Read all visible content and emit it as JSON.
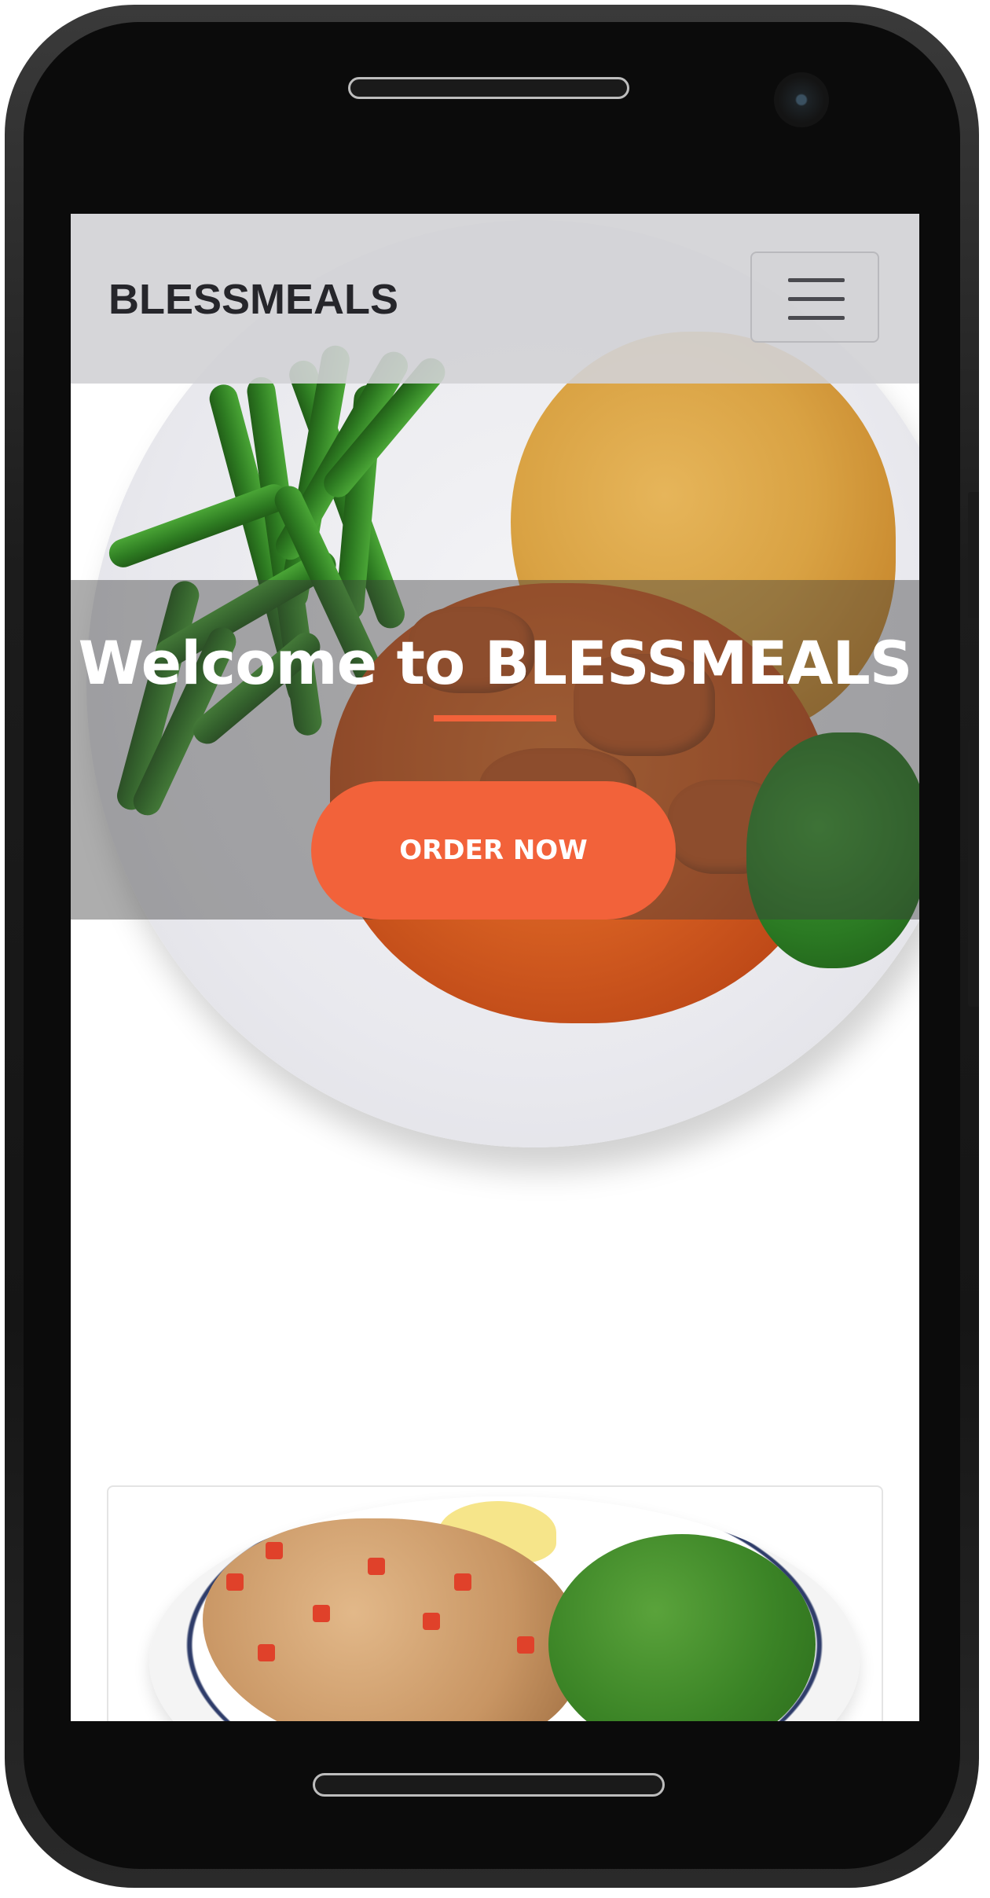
{
  "navbar": {
    "brand": "BLESSMEALS",
    "menu_toggle_icon": "hamburger-menu-icon"
  },
  "hero": {
    "title": "Welcome to BLESSMEALS",
    "cta_label": "ORDER NOW",
    "accent_color": "#f2623a",
    "image": "plate-green-beans-rice-chicken"
  },
  "menu_card": {
    "image": "plate-chicken-mushrooms-broccoli"
  }
}
